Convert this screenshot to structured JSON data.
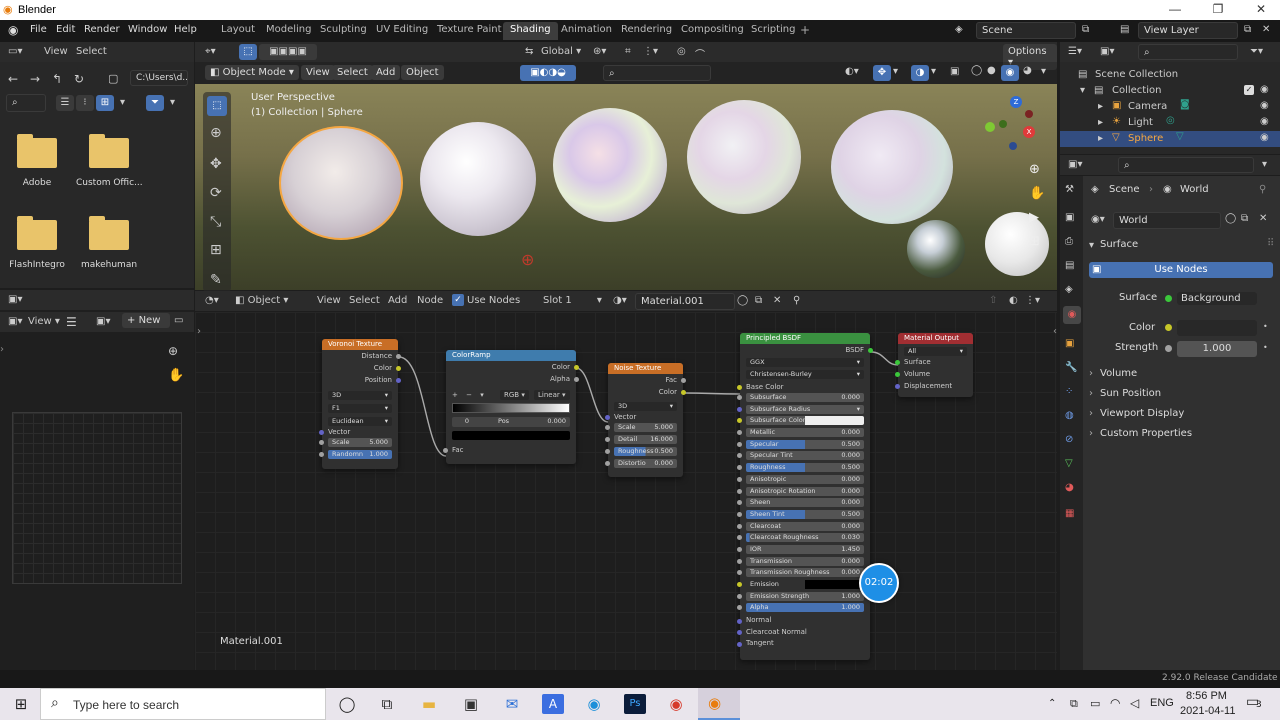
{
  "window": {
    "title": "Blender"
  },
  "menus": [
    "File",
    "Edit",
    "Render",
    "Window",
    "Help"
  ],
  "workspace_tabs": [
    "Layout",
    "Modeling",
    "Sculpting",
    "UV Editing",
    "Texture Paint",
    "Shading",
    "Animation",
    "Rendering",
    "Compositing",
    "Scripting"
  ],
  "active_tab": "Shading",
  "scene": "Scene",
  "view_layer": "View Layer",
  "filebrowser": {
    "menu_view": "View",
    "menu_select": "Select",
    "path": "C:\\Users\\d...",
    "folders": [
      "Adobe",
      "Custom Offic...",
      "FlashIntegro",
      "makehuman"
    ]
  },
  "image_editor": {
    "view": "View",
    "new": "New"
  },
  "viewport_header": {
    "mode": "Object Mode",
    "view": "View",
    "select": "Select",
    "add": "Add",
    "object": "Object",
    "transform": "Global",
    "options": "Options"
  },
  "viewport": {
    "perspective": "User Perspective",
    "collection_info": "(1) Collection | Sphere"
  },
  "gizmo_axes": {
    "z": "Z",
    "x": "X",
    "y": "Y"
  },
  "node_header": {
    "type": "Object",
    "view": "View",
    "select": "Select",
    "add": "Add",
    "node": "Node",
    "use_nodes": "Use Nodes",
    "slot": "Slot 1",
    "material": "Material.001"
  },
  "node_editor": {
    "material_label": "Material.001",
    "timer": "02:02"
  },
  "nodes": {
    "voronoi": {
      "title": "Voronoi Texture",
      "outputs": [
        "Distance",
        "Color",
        "Position"
      ],
      "dims": "3D",
      "feature": "F1",
      "metric": "Euclidean",
      "vector": "Vector",
      "scale_label": "Scale",
      "scale": "5.000",
      "randomness_label": "Randomn",
      "randomness": "1.000"
    },
    "colorramp": {
      "title": "ColorRamp",
      "outputs": [
        "Color",
        "Alpha"
      ],
      "mode": "RGB",
      "interp": "Linear",
      "index": "0",
      "pos_label": "Pos",
      "pos": "0.000",
      "input": "Fac"
    },
    "noise": {
      "title": "Noise Texture",
      "outputs": [
        "Fac",
        "Color"
      ],
      "dims": "3D",
      "vector": "Vector",
      "fields": [
        {
          "label": "Scale",
          "value": "5.000"
        },
        {
          "label": "Detail",
          "value": "16.000"
        },
        {
          "label": "Roughness",
          "value": "0.500"
        },
        {
          "label": "Distortio",
          "value": "0.000"
        }
      ]
    },
    "bsdf": {
      "title": "Principled BSDF",
      "output": "BSDF",
      "distribution": "GGX",
      "subsurface_method": "Christensen-Burley",
      "base_color": "Base Color",
      "fields": [
        {
          "label": "Subsurface",
          "value": "0.000",
          "fill": 0
        },
        {
          "label": "Subsurface Radius",
          "value": "",
          "fill": 0
        },
        {
          "label": "Subsurface Color",
          "value": "",
          "fill": 0
        },
        {
          "label": "Metallic",
          "value": "0.000",
          "fill": 0
        },
        {
          "label": "Specular",
          "value": "0.500",
          "fill": 0.5
        },
        {
          "label": "Specular Tint",
          "value": "0.000",
          "fill": 0
        },
        {
          "label": "Roughness",
          "value": "0.500",
          "fill": 0.5
        },
        {
          "label": "Anisotropic",
          "value": "0.000",
          "fill": 0
        },
        {
          "label": "Anisotropic Rotation",
          "value": "0.000",
          "fill": 0
        },
        {
          "label": "Sheen",
          "value": "0.000",
          "fill": 0
        },
        {
          "label": "Sheen Tint",
          "value": "0.500",
          "fill": 0.5
        },
        {
          "label": "Clearcoat",
          "value": "0.000",
          "fill": 0
        },
        {
          "label": "Clearcoat Roughness",
          "value": "0.030",
          "fill": 0.03
        },
        {
          "label": "IOR",
          "value": "1.450",
          "fill": 0
        },
        {
          "label": "Transmission",
          "value": "0.000",
          "fill": 0
        },
        {
          "label": "Transmission Roughness",
          "value": "0.000",
          "fill": 0
        },
        {
          "label": "Emission",
          "value": "",
          "fill": 0
        },
        {
          "label": "Emission Strength",
          "value": "1.000",
          "fill": 0
        },
        {
          "label": "Alpha",
          "value": "1.000",
          "fill": 1
        },
        {
          "label": "Normal",
          "value": "",
          "fill": 0
        },
        {
          "label": "Clearcoat Normal",
          "value": "",
          "fill": 0
        },
        {
          "label": "Tangent",
          "value": "",
          "fill": 0
        }
      ]
    },
    "output": {
      "title": "Material Output",
      "target": "All",
      "inputs": [
        "Surface",
        "Volume",
        "Displacement"
      ]
    }
  },
  "outliner": {
    "root": "Scene Collection",
    "items": [
      "Collection",
      "Camera",
      "Light",
      "Sphere"
    ]
  },
  "properties": {
    "crumb_scene": "Scene",
    "crumb_world": "World",
    "world_name": "World",
    "surface_panel": "Surface",
    "use_nodes": "Use Nodes",
    "surface_label": "Surface",
    "surface_value": "Background",
    "color_label": "Color",
    "strength_label": "Strength",
    "strength_value": "1.000",
    "subpanels": [
      "Volume",
      "Sun Position",
      "Viewport Display",
      "Custom Properties"
    ]
  },
  "statusbar": {
    "version": "2.92.0 Release Candidate"
  },
  "taskbar": {
    "search": "Type here to search",
    "lang": "ENG",
    "time": "8:56 PM",
    "date": "2021-04-11",
    "notif": "3"
  },
  "colors": {
    "accent": "#4772b3",
    "selected": "#f5a742",
    "node_tex": "#c86e26",
    "node_ramp": "#3f7cad",
    "node_shader": "#3a9140",
    "node_output": "#a12e32"
  }
}
